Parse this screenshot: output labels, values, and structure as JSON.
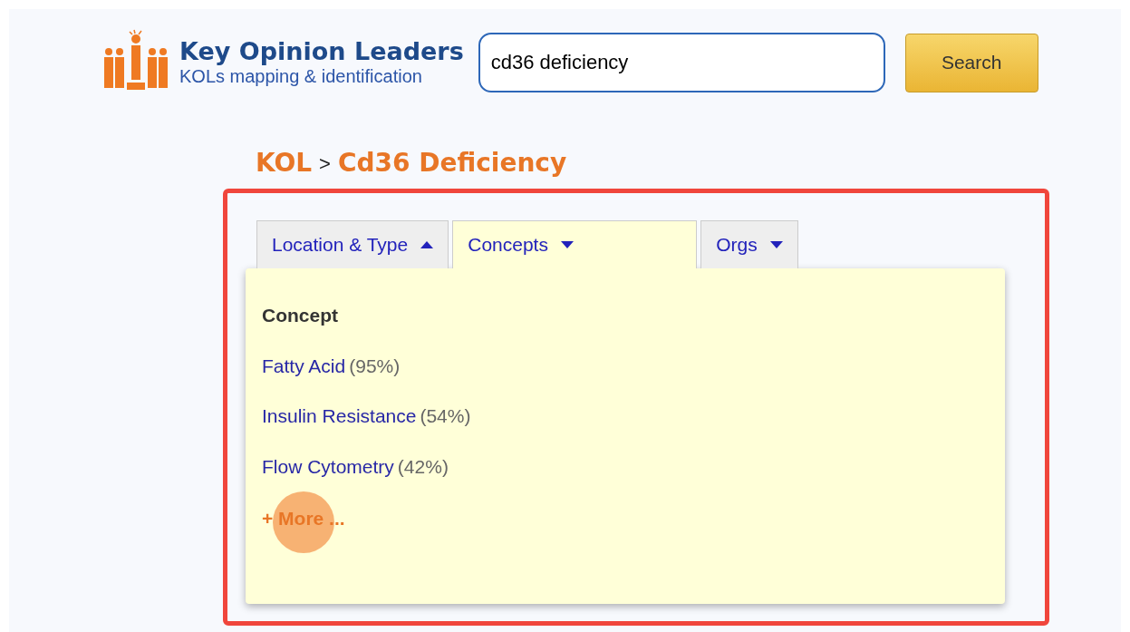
{
  "header": {
    "title": "Key Opinion Leaders",
    "subtitle": "KOLs mapping & identification"
  },
  "search": {
    "value": "cd36 deficiency",
    "button": "Search"
  },
  "breadcrumb": {
    "root": "KOL",
    "separator": ">",
    "current": "Cd36 Deficiency"
  },
  "tabs": [
    {
      "label": "Location & Type",
      "selected": false,
      "caret_up": true
    },
    {
      "label": "Concepts",
      "selected": true,
      "caret_up": false
    },
    {
      "label": "Orgs",
      "selected": false,
      "caret_up": false
    }
  ],
  "panel": {
    "heading": "Concept",
    "items": [
      {
        "label": "Fatty Acid",
        "share": "(95%)"
      },
      {
        "label": "Insulin Resistance",
        "share": "(54%)"
      },
      {
        "label": "Flow Cytometry",
        "share": "(42%)"
      }
    ],
    "more": "+ More ..."
  }
}
